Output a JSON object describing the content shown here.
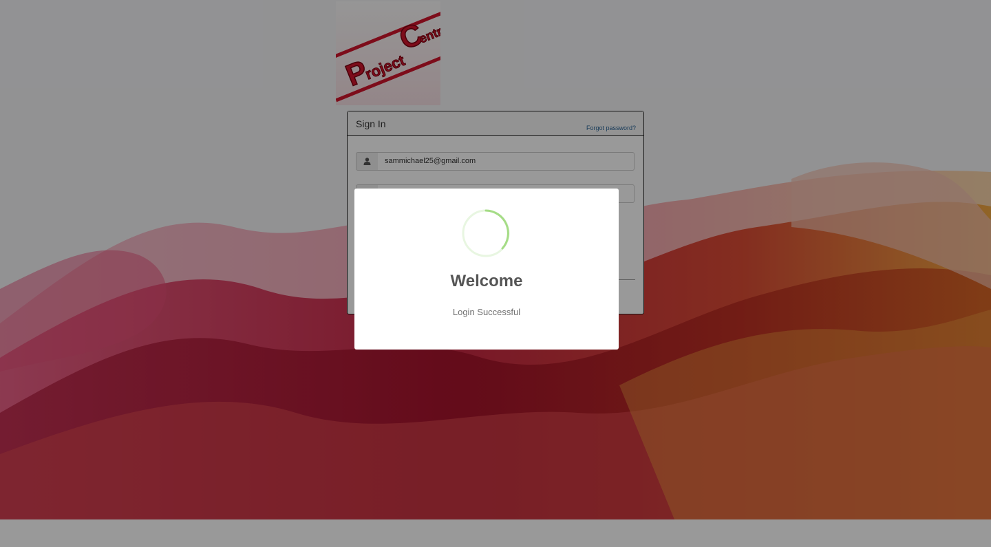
{
  "logo": {
    "word1": "Project",
    "word2": "Central",
    "accent": "#d0142c"
  },
  "signin": {
    "title": "Sign In",
    "forgot_password": "Forgot password?",
    "username_value": "sammichael25@gmail.com",
    "username_icon": "user-icon",
    "password_value": ""
  },
  "modal": {
    "title": "Welcome",
    "message": "Login Successful",
    "spinner_color": "#a5dc86"
  }
}
